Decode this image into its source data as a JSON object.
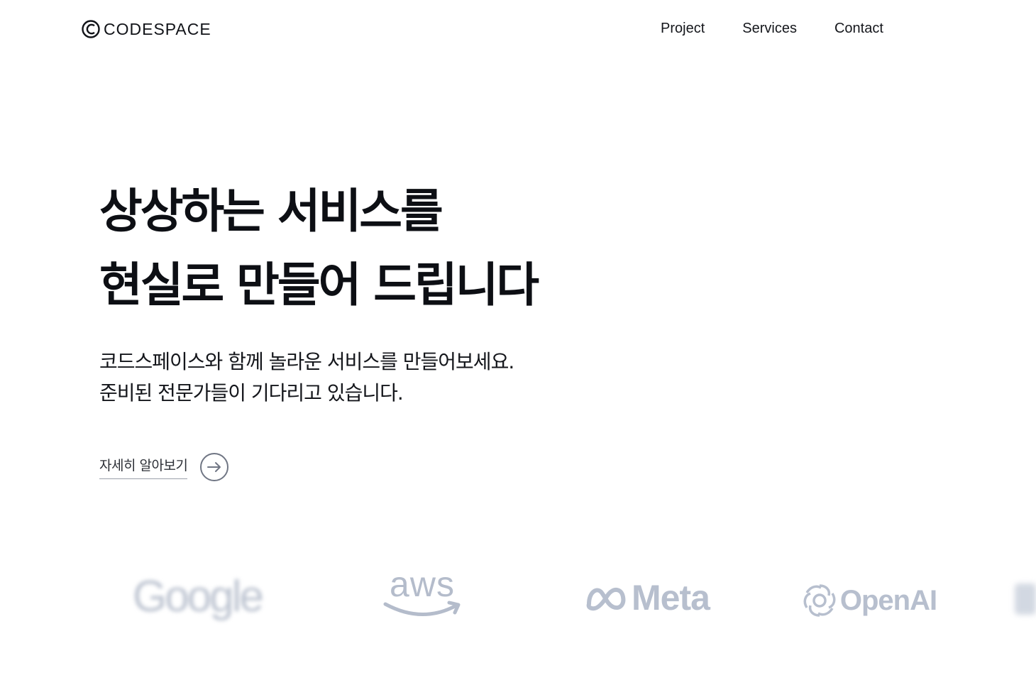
{
  "header": {
    "brand": "CODESPACE",
    "nav": [
      {
        "label": "Project"
      },
      {
        "label": "Services"
      },
      {
        "label": "Contact"
      }
    ]
  },
  "hero": {
    "title_line1": "상상하는 서비스를",
    "title_line2": "현실로 만들어 드립니다",
    "desc_line1": "코드스페이스와 함께 놀라운 서비스를 만들어보세요.",
    "desc_line2": "준비된 전문가들이 기다리고 있습니다.",
    "cta_label": "자세히 알아보기"
  },
  "logos": [
    {
      "name": "Google",
      "icon": "google-logo"
    },
    {
      "name": "aws",
      "icon": "aws-logo"
    },
    {
      "name": "Meta",
      "icon": "meta-logo"
    },
    {
      "name": "OpenAI",
      "icon": "openai-logo"
    }
  ],
  "colors": {
    "text": "#0d0f14",
    "logo_gray": "#b7bfce",
    "arrow_circle": "#707684"
  }
}
